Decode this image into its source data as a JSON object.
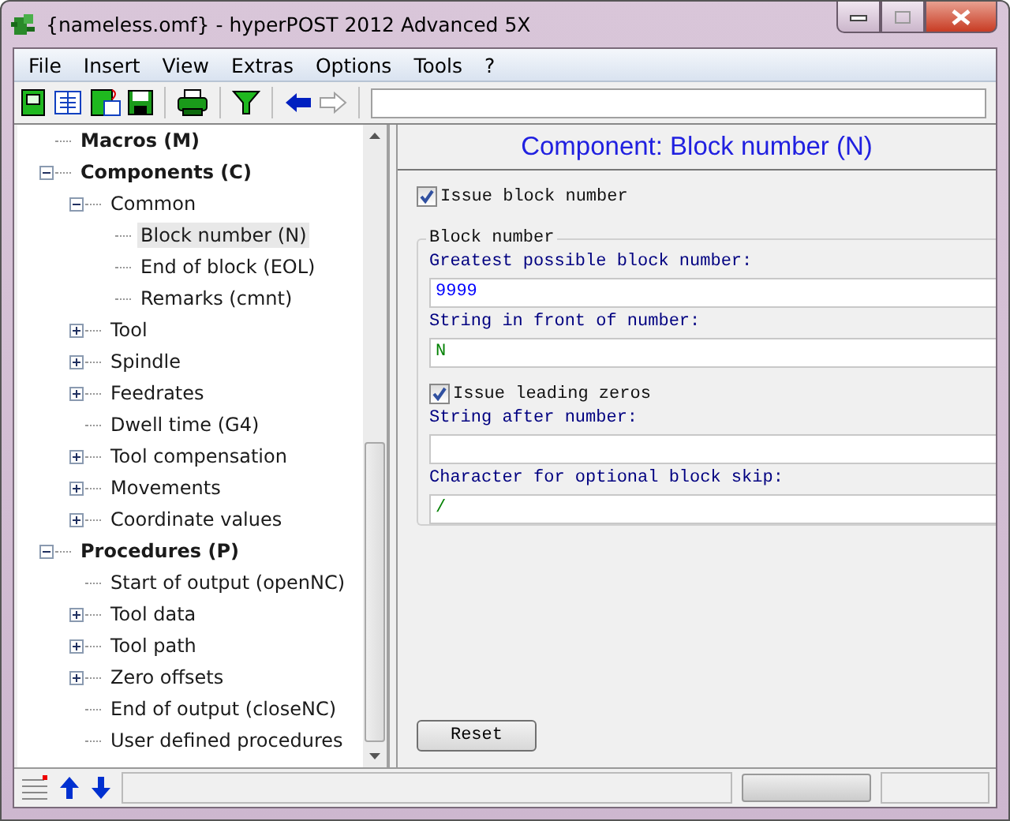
{
  "window": {
    "title": "{nameless.omf} - hyperPOST 2012 Advanced 5X"
  },
  "menu": [
    "File",
    "Insert",
    "View",
    "Extras",
    "Options",
    "Tools",
    "?"
  ],
  "tree": [
    {
      "label": "Macros (M)",
      "selected": false
    },
    {
      "label": "Components (C)",
      "selected": false,
      "expanded": true,
      "children": [
        {
          "label": "Common",
          "selected": false,
          "expanded": true,
          "children": [
            {
              "label": "Block number (N)",
              "selected": true
            },
            {
              "label": "End of block (EOL)",
              "selected": false
            },
            {
              "label": "Remarks (cmnt)",
              "selected": false
            }
          ]
        },
        {
          "label": "Tool",
          "selected": false,
          "expanded": false
        },
        {
          "label": "Spindle",
          "selected": false,
          "expanded": false
        },
        {
          "label": "Feedrates",
          "selected": false,
          "expanded": false
        },
        {
          "label": "Dwell time (G4)",
          "selected": false
        },
        {
          "label": "Tool compensation",
          "selected": false,
          "expanded": false
        },
        {
          "label": "Movements",
          "selected": false,
          "expanded": false
        },
        {
          "label": "Coordinate values",
          "selected": false,
          "expanded": false
        }
      ]
    },
    {
      "label": "Procedures (P)",
      "selected": false,
      "expanded": true,
      "children": [
        {
          "label": "Start of output (openNC)",
          "selected": false
        },
        {
          "label": "Tool data",
          "selected": false,
          "expanded": false
        },
        {
          "label": "Tool path",
          "selected": false,
          "expanded": false
        },
        {
          "label": "Zero offsets",
          "selected": false,
          "expanded": false
        },
        {
          "label": "End of output (closeNC)",
          "selected": false
        },
        {
          "label": "User defined procedures",
          "selected": false
        }
      ]
    }
  ],
  "panel": {
    "title": "Component: Block number (N)",
    "issue": {
      "label": "Issue block number",
      "checked": true
    },
    "group": {
      "title": "Block number",
      "items": [
        {
          "kind": "text",
          "label": "Greatest possible block number:",
          "value": "9999",
          "color": "#0000ff"
        },
        {
          "kind": "text",
          "label": "String in front of number:",
          "value": "N",
          "color": "#008000"
        },
        {
          "kind": "checkbox",
          "label": "Issue leading zeros",
          "checked": true
        },
        {
          "kind": "text",
          "label": "String after number:"
        },
        {
          "kind": "text",
          "label": "Character for optional block skip:",
          "value": "/",
          "color": "#008000"
        }
      ]
    },
    "reset": "Reset"
  }
}
